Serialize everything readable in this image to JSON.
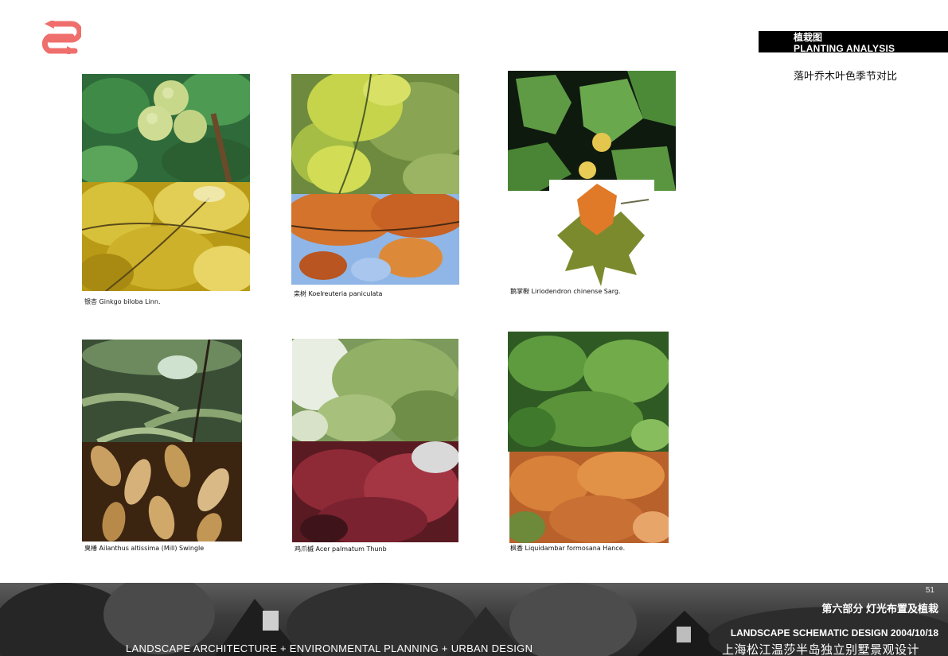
{
  "colors": {
    "logo": "#ef6f6c",
    "header_bg": "#000000",
    "header_text": "#ffffff",
    "footer_bg": "#3a3a3a"
  },
  "logo": {
    "icon": "double-arrow-logo-icon"
  },
  "header": {
    "title_cn": "植栽图",
    "title_en": "PLANTING ANALYSIS",
    "subtitle": "落叶乔木叶色季节对比"
  },
  "plants": [
    {
      "caption": "银杏 Ginkgo biloba Linn.",
      "photos": [
        "ginkgo-fruit-summer-photo",
        "ginkgo-autumn-photo"
      ]
    },
    {
      "caption": "栾树 Koelreuteria paniculata",
      "photos": [
        "koelreuteria-flower-summer-photo",
        "koelreuteria-autumn-photo"
      ]
    },
    {
      "caption": "鹅掌楸 Liriodendron chinense Sarg.",
      "photos": [
        "liriodendron-summer-photo",
        "liriodendron-autumn-leaf-photo"
      ]
    },
    {
      "caption": "臭椿 Ailanthus altissima (Mill) Swingle",
      "photos": [
        "ailanthus-summer-photo",
        "ailanthus-autumn-photo"
      ]
    },
    {
      "caption": "鸡爪槭 Acer palmatum Thunb",
      "photos": [
        "acer-summer-photo",
        "acer-red-autumn-photo"
      ]
    },
    {
      "caption": "枫香 Liquidambar formosana Hance.",
      "photos": [
        "liquidambar-summer-photo",
        "liquidambar-autumn-photo"
      ]
    }
  ],
  "footer": {
    "page_number": "51",
    "section": "第六部分  灯光布置及植栽",
    "design": "LANDSCAPE SCHEMATIC DESIGN 2004/10/18",
    "project": "上海松江温莎半岛独立别墅景观设计",
    "tagline": "LANDSCAPE ARCHITECTURE + ENVIRONMENTAL PLANNING + URBAN DESIGN"
  }
}
